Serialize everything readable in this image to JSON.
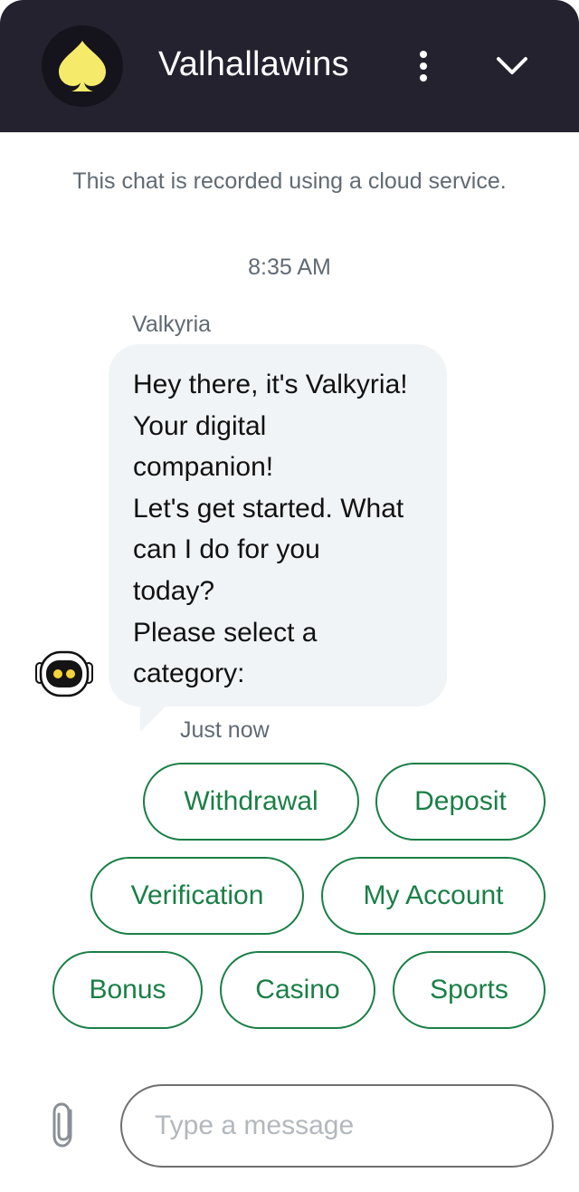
{
  "header": {
    "title": "Valhallawins",
    "logo_icon": "spade-icon",
    "menu_icon": "kebab-menu-icon",
    "collapse_icon": "chevron-down-icon",
    "background": "#24222f",
    "logo_color": "#f6ea6b"
  },
  "notice": "This chat is recorded using a cloud service.",
  "conversation": {
    "timestamp": "8:35 AM",
    "message": {
      "sender": "Valkyria",
      "avatar_icon": "robot-icon",
      "lines": [
        "Hey there, it's Valkyria!",
        "Your digital",
        "companion!",
        "Let's get started. What",
        "can I do for you",
        "today?",
        "Please select a",
        "category:"
      ],
      "time": "Just now"
    }
  },
  "quick_replies": [
    "Withdrawal",
    "Deposit",
    "Verification",
    "My Account",
    "Bonus",
    "Casino",
    "Sports"
  ],
  "composer": {
    "attach_icon": "paperclip-icon",
    "placeholder": "Type a message"
  },
  "colors": {
    "accent_green": "#1a7f46",
    "bubble_bg": "#f1f4f7",
    "muted_text": "#606a73"
  }
}
